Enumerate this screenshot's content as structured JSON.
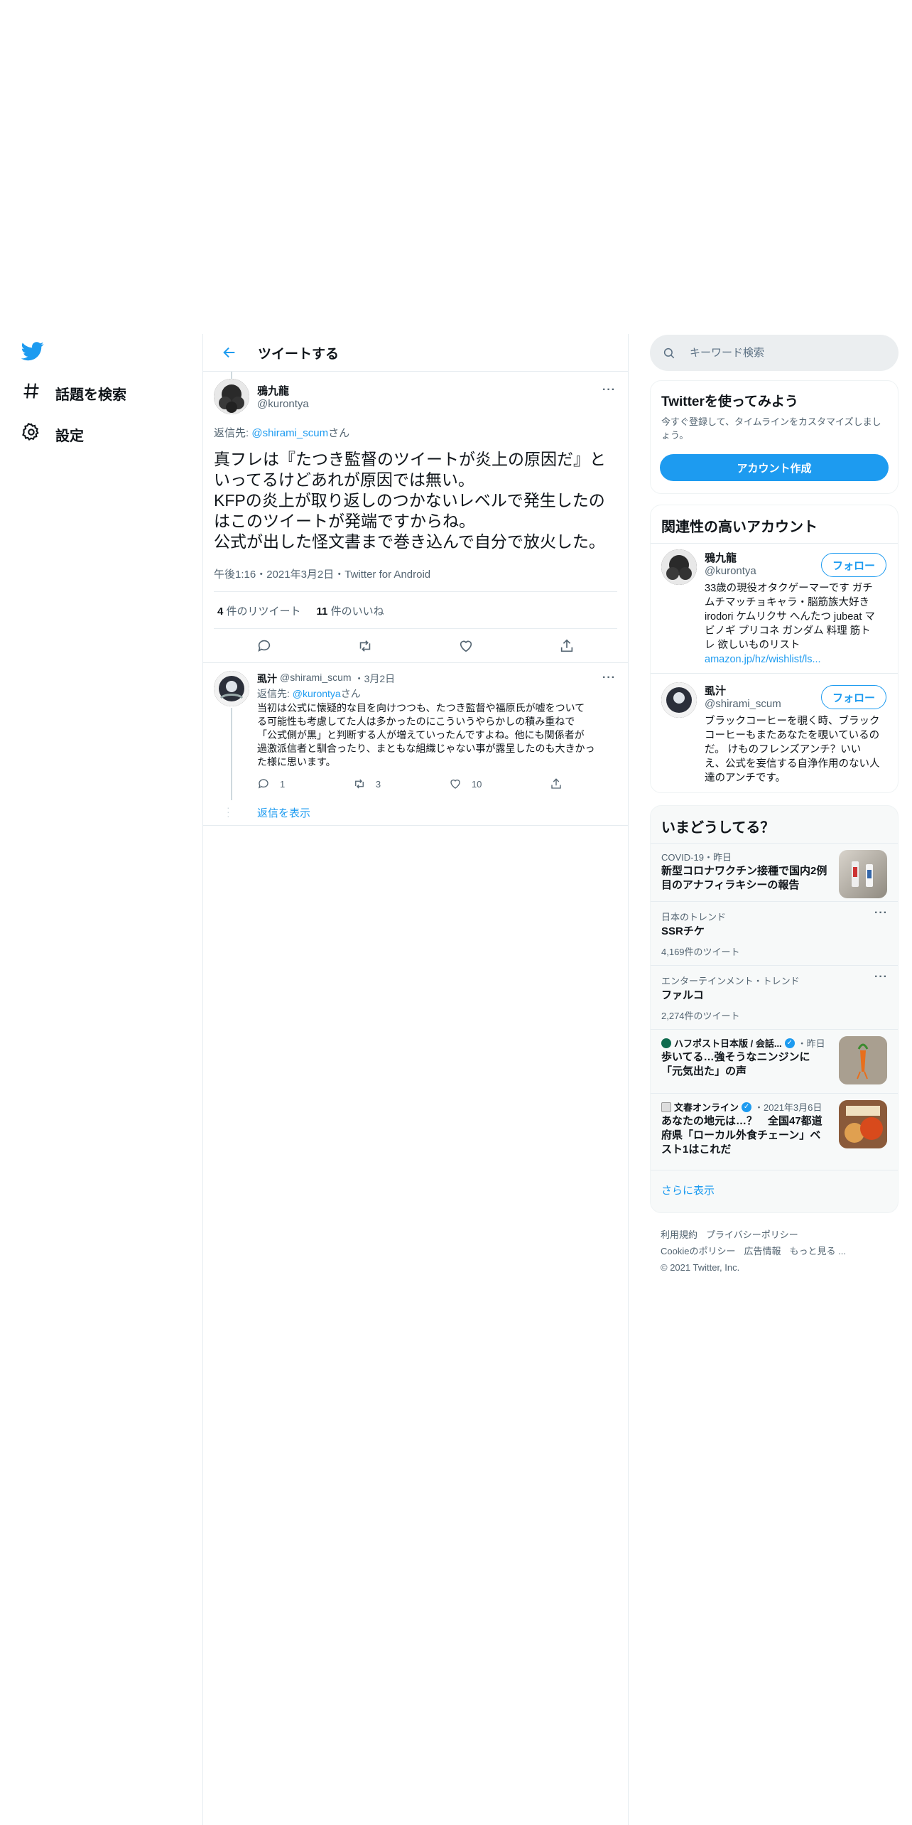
{
  "nav": {
    "explore_label": "話題を検索",
    "settings_label": "設定"
  },
  "header": {
    "title": "ツイートする"
  },
  "main_tweet": {
    "name": "鴉九龍",
    "handle": "@kurontya",
    "reply_prefix": "返信先: ",
    "reply_to": "@shirami_scum",
    "reply_suffix": "さん",
    "lines": [
      "真フレは『たつき監督のツイートが炎上の原因だ』と",
      "いってるけどあれが原因では無い。",
      "KFPの炎上が取り返しのつかないレベルで発生したの",
      "はこのツイートが発端ですからね。",
      "公式が出した怪文書まで巻き込んで自分で放火した。"
    ],
    "timestamp": "午後1:16・2021年3月2日・Twitter for Android",
    "retweet_count": "4",
    "retweet_label": "件のリツイート",
    "like_count": "11",
    "like_label": "件のいいね"
  },
  "reply_tweet": {
    "name": "虱汁",
    "handle": "@shirami_scum",
    "date": "・3月2日",
    "reply_prefix": "返信先: ",
    "reply_to": "@kurontya",
    "reply_suffix": "さん",
    "lines": [
      "当初は公式に懐疑的な目を向けつつも、たつき監督や福原氏が嘘をついて",
      "る可能性も考慮してた人は多かったのにこういうやらかしの積み重ねで",
      "「公式側が黒」と判断する人が増えていったんですよね。他にも関係者が",
      "過激派信者と馴合ったり、まともな組織じゃない事が露呈したのも大きかっ",
      "た様に思います。"
    ],
    "reply_count": "1",
    "retweet_count": "3",
    "like_count": "10",
    "show_replies": "返信を表示"
  },
  "search": {
    "placeholder": "キーワード検索"
  },
  "signup": {
    "title": "Twitterを使ってみよう",
    "description": "今すぐ登録して、タイムラインをカスタマイズしましょう。",
    "button": "アカウント作成"
  },
  "related": {
    "title": "関連性の高いアカウント",
    "accounts": [
      {
        "name": "鴉九龍",
        "handle": "@kurontya",
        "follow": "フォロー",
        "bio_lines": [
          "33歳の現役オタクゲーマーです ガチ",
          "ムチマッチョキャラ・脳筋族大好き",
          "irodori ケムリクサ へんたつ jubeat マ",
          "ビノギ プリコネ ガンダム 料理 筋ト",
          "レ 欲しいものリスト"
        ],
        "bio_link": "amazon.jp/hz/wishlist/ls..."
      },
      {
        "name": "虱汁",
        "handle": "@shirami_scum",
        "follow": "フォロー",
        "bio_lines": [
          "ブラックコーヒーを覗く時、ブラック",
          "コーヒーもまたあなたを覗いているの",
          "だ。 けものフレンズアンチ？いい",
          "え、公式を妄信する自浄作用のない人",
          "達のアンチです。"
        ]
      }
    ]
  },
  "trends": {
    "title": "いまどうしてる？",
    "items": [
      {
        "sub": "COVID-19・昨日",
        "lines": [
          "新型コロナワクチン接種で国内2例",
          "目のアナフィラキシーの報告"
        ]
      },
      {
        "sub": "日本のトレンド",
        "title": "SSRチケ",
        "count": "4,169件のツイート"
      },
      {
        "sub": "エンターテインメント・トレンド",
        "title": "ファルコ",
        "count": "2,274件のツイート"
      },
      {
        "source": "ハフポスト日本版 / 会話...",
        "time": "・昨日",
        "lines": [
          "歩いてる…強そうなニンジンに",
          "「元気出た」の声"
        ]
      },
      {
        "source": "文春オンライン",
        "time": "・2021年3月6日",
        "lines": [
          "あなたの地元は…？　全国47都道",
          "府県「ローカル外食チェーン」ベ",
          "スト1はこれだ"
        ]
      }
    ],
    "show_more": "さらに表示"
  },
  "footer": {
    "terms": "利用規約",
    "privacy": "プライバシーポリシー",
    "cookie": "Cookieのポリシー",
    "ads": "広告情報",
    "more": "もっと見る ...",
    "copyright": "© 2021 Twitter, Inc."
  },
  "colors": {
    "accent": "#1d9bf0",
    "text": "#0f1419",
    "secondary": "#536471"
  }
}
